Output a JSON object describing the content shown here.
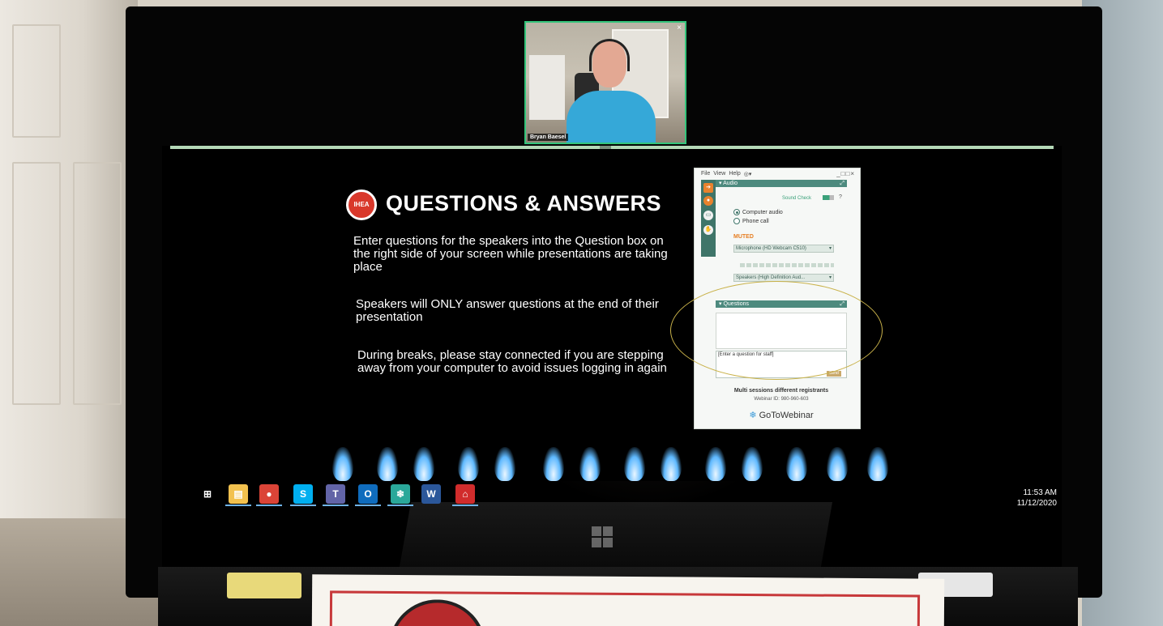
{
  "video": {
    "participant_name": "Bryan Baesel",
    "close_glyph": "×"
  },
  "slide": {
    "logo_text": "IHEA",
    "title": "QUESTIONS & ANSWERS",
    "paragraphs": [
      "Enter questions for the speakers into the Question box on the right side of your screen while presentations are taking place",
      "Speakers will ONLY answer questions at the end of their presentation",
      "During breaks, please stay connected if you are stepping away from your computer to avoid issues logging in again"
    ]
  },
  "gotowebinar": {
    "menu": [
      "File",
      "View",
      "Help"
    ],
    "globe_menu": "◎▾",
    "window_controls": "_□□×",
    "audio_header": "▾ Audio",
    "popout_glyph": "⤢",
    "sound_check": "Sound Check",
    "help_glyph": "?",
    "audio_options": [
      "Computer audio",
      "Phone call"
    ],
    "selected_audio": "Computer audio",
    "muted_label": "MUTED",
    "microphone_select": "Microphone (HD Webcam C510)",
    "speakers_select": "Speakers (High Definition Aud...",
    "questions_header": "▾ Questions",
    "question_placeholder": "[Enter a question for staff]",
    "send_label": "Send",
    "session_title": "Multi sessions different registrants",
    "webinar_id": "Webinar ID: 980-960-603",
    "brand": "GoToWebinar",
    "colors": {
      "accent": "#4d8a7e",
      "muted": "#e67e22",
      "active_tab": "#e8822d"
    }
  },
  "taskbar": {
    "icons": [
      {
        "name": "start-icon",
        "glyph": "⊞",
        "color": "#ffffff"
      },
      {
        "name": "file-explorer-icon",
        "glyph": "▤",
        "color": "#f2c14e"
      },
      {
        "name": "chrome-icon",
        "glyph": "●",
        "color": "#db4437"
      },
      {
        "name": "skype-icon",
        "glyph": "S",
        "color": "#00aff0"
      },
      {
        "name": "teams-icon",
        "glyph": "T",
        "color": "#6264a7"
      },
      {
        "name": "outlook-icon",
        "glyph": "O",
        "color": "#0f6cbd"
      },
      {
        "name": "gotowebinar-icon",
        "glyph": "❄",
        "color": "#2aa89a"
      },
      {
        "name": "word-icon",
        "glyph": "W",
        "color": "#2b579a"
      },
      {
        "name": "acrobat-icon",
        "glyph": "⌂",
        "color": "#d12c2c"
      }
    ],
    "time": "11:53 AM",
    "date": "11/12/2020"
  }
}
